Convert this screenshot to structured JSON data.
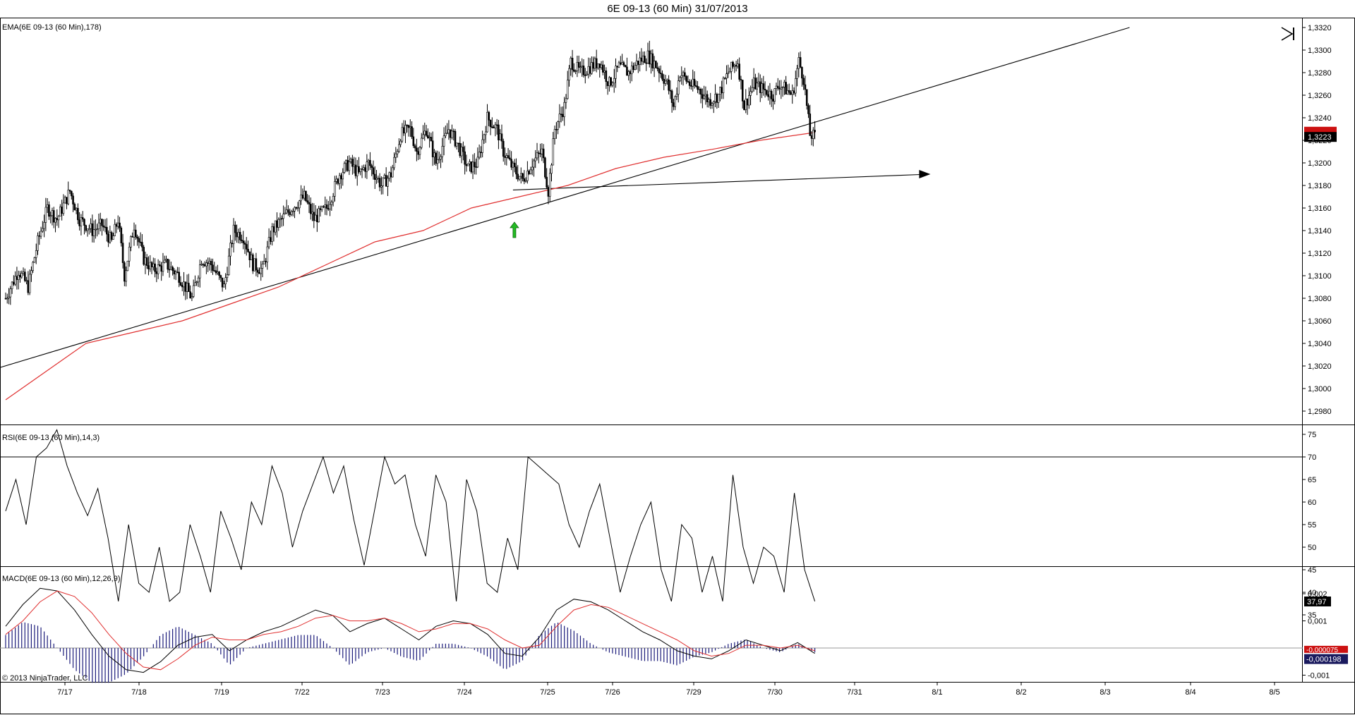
{
  "chart_title": "6E 09-13 (60 Min)  31/07/2013",
  "copyright": "© 2013 NinjaTrader, LLC",
  "colors": {
    "ema": "#e03030",
    "price_box": "#000000",
    "ema_box": "#cc1111",
    "macd_box": "#1a1a5e",
    "hist": "#1a1a7a",
    "arrow_up": "#22bb22"
  },
  "icons": {
    "skip": "skip-to-end-icon",
    "up_arrow": "up-arrow-icon"
  },
  "chart_data": [
    {
      "type": "candlestick",
      "panel_title": "EMA(6E 09-13 (60 Min),178)",
      "x_tick_labels": [
        "7/17",
        "7/18",
        "7/19",
        "7/22",
        "7/23",
        "7/24",
        "7/25",
        "7/26",
        "7/29",
        "7/30",
        "7/31",
        "8/1",
        "8/2",
        "8/3",
        "8/4",
        "8/5"
      ],
      "y_tick_labels": [
        "1,3320",
        "1,3300",
        "1,3280",
        "1,3260",
        "1,3240",
        "1,3220",
        "1,3200",
        "1,3180",
        "1,3160",
        "1,3140",
        "1,3120",
        "1,3100",
        "1,3080",
        "1,3060",
        "1,3040",
        "1,3020",
        "1,3000",
        "1,2980"
      ],
      "ylim": [
        1.297,
        1.3325
      ],
      "last_price_label": "1,3223",
      "ema_last_value": 1.3227,
      "price_path": [
        [
          0,
          1.308
        ],
        [
          8,
          1.3105
        ],
        [
          14,
          1.309
        ],
        [
          20,
          1.313
        ],
        [
          26,
          1.316
        ],
        [
          32,
          1.315
        ],
        [
          40,
          1.3175
        ],
        [
          46,
          1.315
        ],
        [
          54,
          1.314
        ],
        [
          60,
          1.3145
        ],
        [
          66,
          1.313
        ],
        [
          70,
          1.315
        ],
        [
          74,
          1.31
        ],
        [
          80,
          1.3145
        ],
        [
          86,
          1.3115
        ],
        [
          92,
          1.3105
        ],
        [
          100,
          1.311
        ],
        [
          108,
          1.31
        ],
        [
          116,
          1.308
        ],
        [
          122,
          1.3115
        ],
        [
          128,
          1.311
        ],
        [
          136,
          1.309
        ],
        [
          142,
          1.314
        ],
        [
          148,
          1.3135
        ],
        [
          154,
          1.311
        ],
        [
          160,
          1.3105
        ],
        [
          166,
          1.314
        ],
        [
          172,
          1.315
        ],
        [
          178,
          1.316
        ],
        [
          186,
          1.317
        ],
        [
          192,
          1.315
        ],
        [
          200,
          1.316
        ],
        [
          208,
          1.319
        ],
        [
          214,
          1.32
        ],
        [
          220,
          1.319
        ],
        [
          226,
          1.32
        ],
        [
          234,
          1.318
        ],
        [
          240,
          1.319
        ],
        [
          246,
          1.3225
        ],
        [
          252,
          1.323
        ],
        [
          256,
          1.321
        ],
        [
          262,
          1.323
        ],
        [
          268,
          1.32
        ],
        [
          276,
          1.323
        ],
        [
          282,
          1.3215
        ],
        [
          288,
          1.3195
        ],
        [
          294,
          1.32
        ],
        [
          300,
          1.324
        ],
        [
          306,
          1.323
        ],
        [
          310,
          1.321
        ],
        [
          316,
          1.3195
        ],
        [
          322,
          1.3185
        ],
        [
          328,
          1.32
        ],
        [
          334,
          1.321
        ],
        [
          338,
          1.3175
        ],
        [
          342,
          1.323
        ],
        [
          348,
          1.325
        ],
        [
          352,
          1.329
        ],
        [
          358,
          1.328
        ],
        [
          364,
          1.3285
        ],
        [
          370,
          1.329
        ],
        [
          376,
          1.327
        ],
        [
          382,
          1.3285
        ],
        [
          388,
          1.328
        ],
        [
          394,
          1.329
        ],
        [
          400,
          1.3295
        ],
        [
          406,
          1.3285
        ],
        [
          412,
          1.327
        ],
        [
          416,
          1.325
        ],
        [
          420,
          1.328
        ],
        [
          426,
          1.327
        ],
        [
          432,
          1.3265
        ],
        [
          438,
          1.3255
        ],
        [
          444,
          1.326
        ],
        [
          450,
          1.328
        ],
        [
          456,
          1.329
        ],
        [
          460,
          1.325
        ],
        [
          466,
          1.327
        ],
        [
          472,
          1.3265
        ],
        [
          478,
          1.326
        ],
        [
          482,
          1.327
        ],
        [
          486,
          1.3265
        ],
        [
          490,
          1.326
        ],
        [
          494,
          1.329
        ],
        [
          497,
          1.3275
        ],
        [
          501,
          1.3225
        ],
        [
          504,
          1.3223
        ]
      ],
      "ema_path": [
        [
          0,
          1.299
        ],
        [
          20,
          1.301
        ],
        [
          50,
          1.304
        ],
        [
          80,
          1.305
        ],
        [
          110,
          1.306
        ],
        [
          140,
          1.3075
        ],
        [
          170,
          1.309
        ],
        [
          200,
          1.311
        ],
        [
          230,
          1.313
        ],
        [
          260,
          1.314
        ],
        [
          290,
          1.316
        ],
        [
          320,
          1.317
        ],
        [
          350,
          1.318
        ],
        [
          380,
          1.3195
        ],
        [
          410,
          1.3205
        ],
        [
          440,
          1.3212
        ],
        [
          470,
          1.322
        ],
        [
          504,
          1.3227
        ]
      ],
      "trendline": [
        [
          -5,
          1.3018
        ],
        [
          700,
          1.332
        ]
      ],
      "horizontal_arrow": [
        [
          316,
          1.3176
        ],
        [
          576,
          1.319
        ]
      ]
    },
    {
      "type": "line",
      "panel_title": "RSI(6E 09-13 (60 Min),14,3)",
      "y_tick_labels": [
        "75",
        "70",
        "65",
        "60",
        "55",
        "50",
        "45",
        "40",
        "35"
      ],
      "ylim": [
        34,
        77
      ],
      "reference_level": 70,
      "last_value_label": "37,97",
      "values": [
        58,
        65,
        55,
        70,
        72,
        76,
        68,
        62,
        57,
        63,
        52,
        38,
        55,
        42,
        40,
        50,
        38,
        40,
        55,
        48,
        40,
        58,
        52,
        45,
        60,
        55,
        68,
        62,
        50,
        58,
        64,
        70,
        62,
        68,
        56,
        46,
        58,
        70,
        64,
        66,
        55,
        48,
        66,
        60,
        38,
        65,
        58,
        42,
        40,
        52,
        45,
        70,
        68,
        66,
        64,
        55,
        50,
        58,
        64,
        52,
        40,
        48,
        55,
        60,
        45,
        38,
        55,
        52,
        40,
        48,
        38,
        66,
        50,
        42,
        50,
        48,
        40,
        62,
        45,
        38
      ]
    },
    {
      "type": "line",
      "panel_title": "MACD(6E 09-13 (60 Min),12,26,9)",
      "y_tick_labels": [
        "0,002",
        "0,001",
        "-0,001"
      ],
      "ylim": [
        -0.00115,
        0.00235
      ],
      "zero_line": 0,
      "last_value_label": "-0,000198",
      "signal_last_label": "-0,000075",
      "macd": [
        0.0008,
        0.0016,
        0.0022,
        0.0021,
        0.0014,
        0.0005,
        -0.0003,
        -0.0008,
        -0.0009,
        -0.0005,
        0.0001,
        0.0004,
        0.0005,
        -0.0001,
        0.0003,
        0.0006,
        0.0008,
        0.0011,
        0.0014,
        0.0012,
        0.0006,
        0.0009,
        0.0011,
        0.0007,
        0.0003,
        0.0008,
        0.001,
        0.0009,
        0.0005,
        -0.0002,
        -0.0003,
        0.0004,
        0.0014,
        0.0018,
        0.0017,
        0.0014,
        0.001,
        0.0006,
        0.0003,
        -0.0001,
        -0.0003,
        -0.0004,
        -0.0001,
        0.0003,
        0.0001,
        -0.0001,
        0.0002,
        -0.0002
      ],
      "signal": [
        0.0005,
        0.001,
        0.0017,
        0.0021,
        0.0019,
        0.0013,
        0.0005,
        -0.0002,
        -0.0007,
        -0.0008,
        -0.0004,
        0.0001,
        0.0004,
        0.0003,
        0.0003,
        0.0005,
        0.0006,
        0.0008,
        0.0011,
        0.0012,
        0.001,
        0.001,
        0.0011,
        0.0009,
        0.0006,
        0.0007,
        0.0009,
        0.0009,
        0.0007,
        0.0003,
        0.0,
        0.0001,
        0.0008,
        0.0014,
        0.0016,
        0.0015,
        0.0012,
        0.0009,
        0.0006,
        0.0003,
        -0.0001,
        -0.0003,
        -0.0002,
        0.0001,
        0.0001,
        0.0,
        0.0001,
        -0.0001
      ]
    }
  ]
}
